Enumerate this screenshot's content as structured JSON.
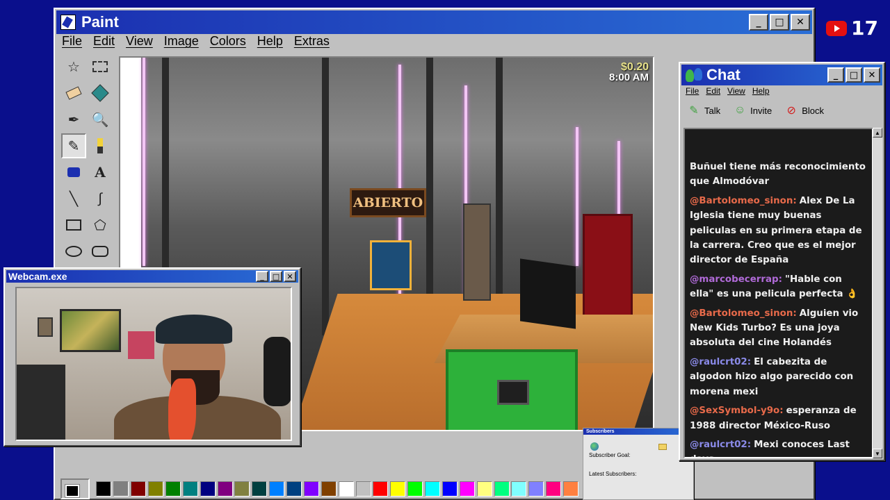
{
  "paint": {
    "title": "Paint",
    "menu": [
      "File",
      "Edit",
      "View",
      "Image",
      "Colors",
      "Help",
      "Extras"
    ],
    "tools": [
      "free-select",
      "rect-select",
      "eraser",
      "fill",
      "color-picker",
      "magnifier",
      "pencil",
      "brush",
      "airbrush",
      "text",
      "line",
      "curve",
      "rectangle",
      "polygon",
      "ellipse",
      "rounded-rectangle"
    ],
    "game_hud": {
      "money": "$0.20",
      "time": "8:00 AM",
      "sign": "ABIERTO"
    },
    "palette": [
      "#000000",
      "#808080",
      "#800000",
      "#808000",
      "#008000",
      "#008080",
      "#000080",
      "#800080",
      "#808040",
      "#004040",
      "#0080ff",
      "#004080",
      "#8000ff",
      "#804000",
      "#ffffff",
      "#c0c0c0",
      "#ff0000",
      "#ffff00",
      "#00ff00",
      "#00ffff",
      "#0000ff",
      "#ff00ff",
      "#ffff80",
      "#00ff80",
      "#80ffff",
      "#8080ff",
      "#ff0080",
      "#ff8040"
    ]
  },
  "webcam": {
    "title": "Webcam.exe"
  },
  "chat": {
    "title": "Chat",
    "menu": [
      "File",
      "Edit",
      "View",
      "Help"
    ],
    "tools": [
      {
        "label": "Talk",
        "icon": "talk-icon"
      },
      {
        "label": "Invite",
        "icon": "invite-icon"
      },
      {
        "label": "Block",
        "icon": "block-icon"
      }
    ],
    "messages": [
      {
        "user": "",
        "color": "#f0f0f0",
        "text": "Buñuel tiene más reconocimiento que Almodóvar"
      },
      {
        "user": "@Bartolomeo_sinon:",
        "color": "#e86a4a",
        "text": "Alex De La Iglesia tiene muy buenas peliculas en su primera etapa de la carrera. Creo que es el mejor director de España"
      },
      {
        "user": "@marcobecerrap:",
        "color": "#b06ad8",
        "text": "\"Hable con ella\" es una pelicula perfecta 👌"
      },
      {
        "user": "@Bartolomeo_sinon:",
        "color": "#e86a4a",
        "text": "Alguien vio New Kids Turbo? Es una joya absoluta del cine Holandés"
      },
      {
        "user": "@raulcrt02:",
        "color": "#8a8ae8",
        "text": "El cabezita de algodon hizo algo parecido con morena mexi"
      },
      {
        "user": "@SexSymbol-y9o:",
        "color": "#e86a4a",
        "text": "esperanza de 1988 director México-Ruso"
      },
      {
        "user": "@raulcrt02:",
        "color": "#8a8ae8",
        "text": "Mexi conoces Last days"
      }
    ]
  },
  "subscribers": {
    "title": "Subscribers",
    "goal_label": "Subscriber Goal:",
    "latest_label": "Latest Subscribers:"
  },
  "youtube": {
    "count": "17"
  }
}
